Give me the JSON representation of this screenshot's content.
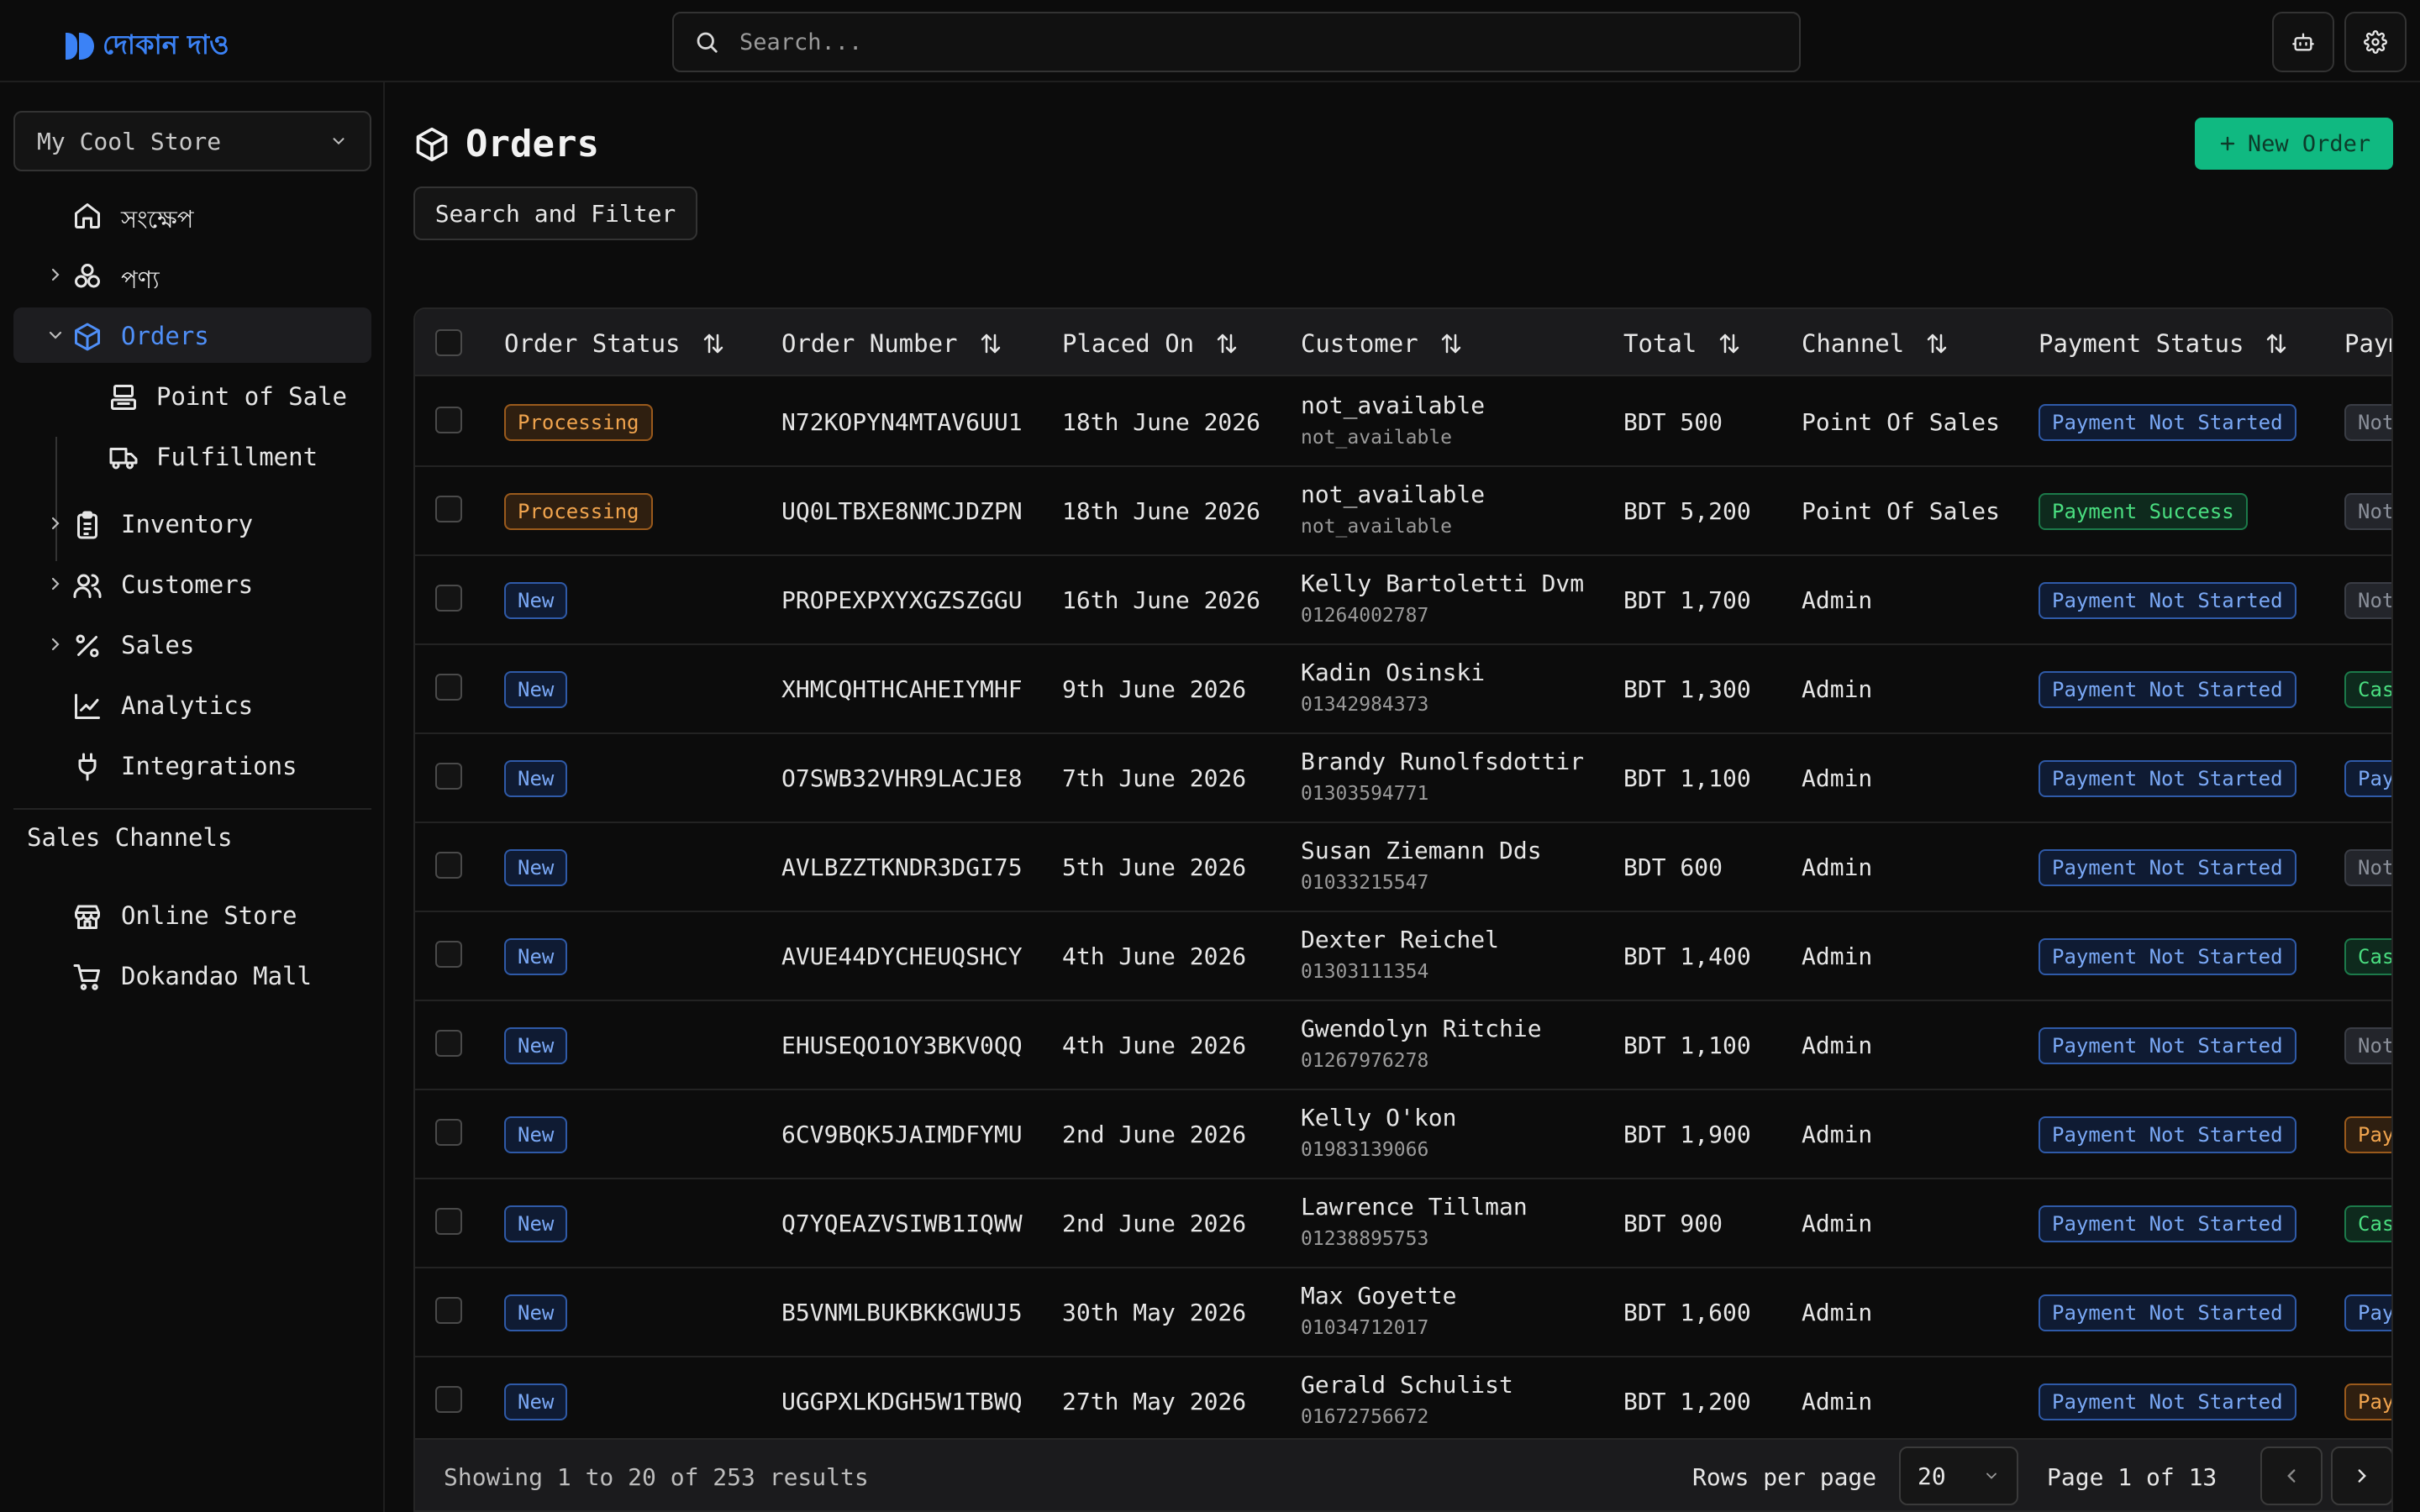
{
  "brand": {
    "name": "দোকান দাও",
    "color": "#3b82f6"
  },
  "search": {
    "placeholder": "Search..."
  },
  "header_buttons": [
    {
      "icon": "robot-icon"
    },
    {
      "icon": "gear-icon"
    }
  ],
  "sidebar": {
    "store": "My Cool Store",
    "items": [
      {
        "label": "সংক্ষেপ",
        "icon": "home-icon"
      },
      {
        "label": "পণ্য",
        "icon": "products-icon"
      },
      {
        "label": "Orders",
        "icon": "box-icon",
        "active": true
      },
      {
        "label": "Point of Sale",
        "icon": "pos-icon"
      },
      {
        "label": "Fulfillment",
        "icon": "truck-icon"
      },
      {
        "label": "Inventory",
        "icon": "clipboard-icon"
      },
      {
        "label": "Customers",
        "icon": "users-icon"
      },
      {
        "label": "Sales",
        "icon": "percent-icon"
      },
      {
        "label": "Analytics",
        "icon": "chart-icon"
      },
      {
        "label": "Integrations",
        "icon": "plug-icon"
      }
    ],
    "channels_heading": "Sales Channels",
    "channels": [
      {
        "label": "Online Store",
        "icon": "store-icon"
      },
      {
        "label": "Dokandao Mall",
        "icon": "cart-icon"
      }
    ]
  },
  "page": {
    "title": "Orders",
    "new_order": "New Order",
    "filter": "Search and Filter"
  },
  "table": {
    "columns": [
      "Order Status",
      "Order Number",
      "Placed On",
      "Customer",
      "Total",
      "Channel",
      "Payment Status",
      "Payment Method"
    ],
    "rows": [
      {
        "status": "Processing",
        "number": "N72KOPYN4MTAV6UU1",
        "placed": "18th June 2026",
        "customer": "not_available",
        "phone": "not_available",
        "total": "BDT 500",
        "channel": "Point Of Sales",
        "payment": "Payment Not Started",
        "method": "Not Available"
      },
      {
        "status": "Processing",
        "number": "UQ0LTBXE8NMCJDZPN",
        "placed": "18th June 2026",
        "customer": "not_available",
        "phone": "not_available",
        "total": "BDT 5,200",
        "channel": "Point Of Sales",
        "payment": "Payment Success",
        "method": "Not Available"
      },
      {
        "status": "New",
        "number": "PROPEXPXYXGZSZGGU",
        "placed": "16th June 2026",
        "customer": "Kelly Bartoletti Dvm",
        "phone": "01264002787",
        "total": "BDT 1,700",
        "channel": "Admin",
        "payment": "Payment Not Started",
        "method": "Not Available"
      },
      {
        "status": "New",
        "number": "XHMCQHTHCAHEIYMHF",
        "placed": "9th June 2026",
        "customer": "Kadin Osinski",
        "phone": "01342984373",
        "total": "BDT 1,300",
        "channel": "Admin",
        "payment": "Payment Not Started",
        "method": "Cash"
      },
      {
        "status": "New",
        "number": "O7SWB32VHR9LACJE8",
        "placed": "7th June 2026",
        "customer": "Brandy Runolfsdottir",
        "phone": "01303594771",
        "total": "BDT 1,100",
        "channel": "Admin",
        "payment": "Payment Not Started",
        "method": "Pay"
      },
      {
        "status": "New",
        "number": "AVLBZZTKNDR3DGI75",
        "placed": "5th June 2026",
        "customer": "Susan Ziemann Dds",
        "phone": "01033215547",
        "total": "BDT 600",
        "channel": "Admin",
        "payment": "Payment Not Started",
        "method": "Not Available"
      },
      {
        "status": "New",
        "number": "AVUE44DYCHEUQSHCY",
        "placed": "4th June 2026",
        "customer": "Dexter Reichel",
        "phone": "01303111354",
        "total": "BDT 1,400",
        "channel": "Admin",
        "payment": "Payment Not Started",
        "method": "Cash"
      },
      {
        "status": "New",
        "number": "EHUSEQO1OY3BKV0QQ",
        "placed": "4th June 2026",
        "customer": "Gwendolyn Ritchie",
        "phone": "01267976278",
        "total": "BDT 1,100",
        "channel": "Admin",
        "payment": "Payment Not Started",
        "method": "Not Available"
      },
      {
        "status": "New",
        "number": "6CV9BQK5JAIMDFYMU",
        "placed": "2nd June 2026",
        "customer": "Kelly O'kon",
        "phone": "01983139066",
        "total": "BDT 1,900",
        "channel": "Admin",
        "payment": "Payment Not Started",
        "method": "Pay"
      },
      {
        "status": "New",
        "number": "Q7YQEAZVSIWB1IQWW",
        "placed": "2nd June 2026",
        "customer": "Lawrence Tillman",
        "phone": "01238895753",
        "total": "BDT 900",
        "channel": "Admin",
        "payment": "Payment Not Started",
        "method": "Cash"
      },
      {
        "status": "New",
        "number": "B5VNMLBUKBKKGWUJ5",
        "placed": "30th May 2026",
        "customer": "Max Goyette",
        "phone": "01034712017",
        "total": "BDT 1,600",
        "channel": "Admin",
        "payment": "Payment Not Started",
        "method": "Pay"
      },
      {
        "status": "New",
        "number": "UGGPXLKDGH5W1TBWQ",
        "placed": "27th May 2026",
        "customer": "Gerald Schulist",
        "phone": "01672756672",
        "total": "BDT 1,200",
        "channel": "Admin",
        "payment": "Payment Not Started",
        "method": "Pay"
      }
    ]
  },
  "footer": {
    "showing": "Showing 1 to 20 of 253 results",
    "rows_per_page_label": "Rows per page",
    "rows_per_page": "20",
    "page_label": "Page 1 of 13"
  }
}
